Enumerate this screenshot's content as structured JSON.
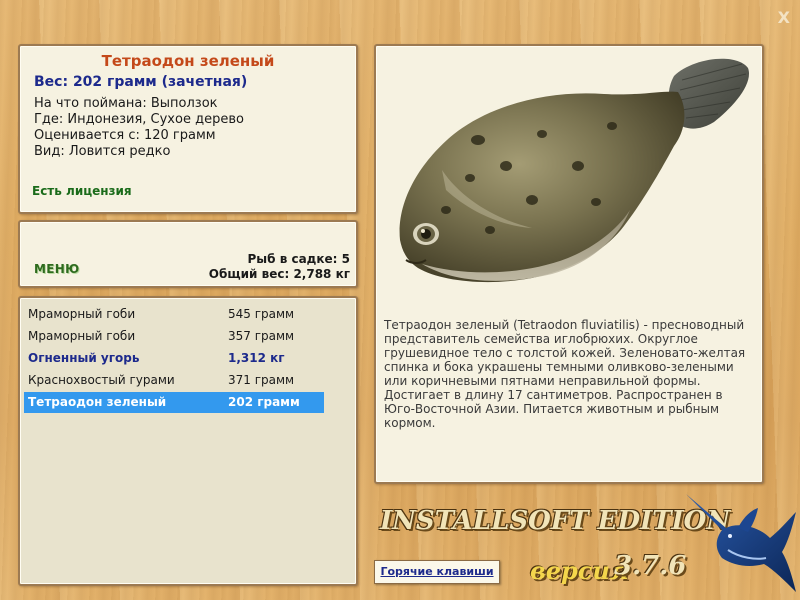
{
  "window": {
    "close_label": "X"
  },
  "fish_info": {
    "title": "Тетраодон зеленый",
    "weight": "Вес: 202 грамм (зачетная)",
    "lines": [
      "На что поймана: Выползок",
      "Где: Индонезия, Сухое дерево",
      "Оценивается с: 120 грамм",
      "Вид: Ловится редко"
    ],
    "license": "Есть лицензия"
  },
  "menu": {
    "label": "МЕНЮ",
    "fish_count": "Рыб в садке: 5",
    "total_weight": "Общий вес: 2,788 кг"
  },
  "catch_list": [
    {
      "name": "Мраморный гоби",
      "weight": "545 грамм",
      "state": "normal"
    },
    {
      "name": "Мраморный гоби",
      "weight": "357 грамм",
      "state": "normal"
    },
    {
      "name": "Огненный угорь",
      "weight": "1,312 кг",
      "state": "highlight"
    },
    {
      "name": "Краснохвостый гурами",
      "weight": "371 грамм",
      "state": "normal"
    },
    {
      "name": "Тетраодон зеленый",
      "weight": "202 грамм",
      "state": "selected"
    }
  ],
  "description": "Тетраодон зеленый (Tetraodon fluviatilis) - пресноводный представитель семейства иглобрюхих. Округлое грушевидное тело с толстой кожей. Зеленовато-желтая спинка и бока украшены темными оливково-зелеными или коричневыми пятнами неправильной формы. Достигает в длину 17 сантиметров. Распространен в Юго-Восточной Азии. Питается животным и рыбным кормом.",
  "footer": {
    "hotkeys_label": "Горячие клавиши",
    "brand": "INSTALLSOFT EDITION",
    "version_label": "версия",
    "version_number": "3.7.6"
  },
  "colors": {
    "title": "#c4491a",
    "weight": "#1d2a8c",
    "license": "#1a6b1a",
    "selected_row": "#3399ee",
    "highlight_row": "#1d2a8c"
  },
  "icons": {
    "close": "close-icon",
    "fish_picture": "pufferfish-image",
    "logo": "marlin-logo"
  }
}
